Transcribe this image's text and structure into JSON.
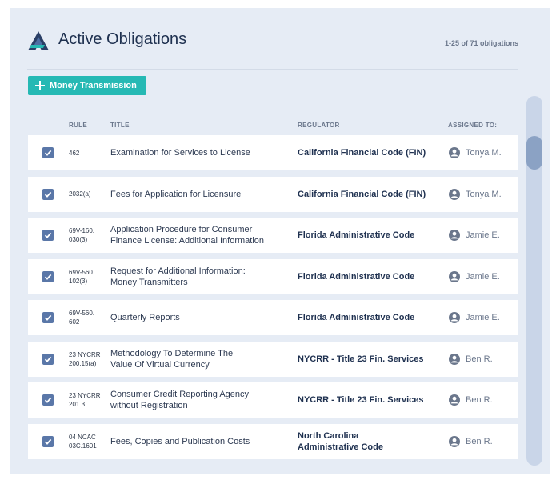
{
  "header": {
    "title": "Active Obligations",
    "count": "1-25 of 71 obligations"
  },
  "add_button": {
    "label": "Money Transmission"
  },
  "columns": {
    "rule": "RULE",
    "title": "TITLE",
    "regulator": "REGULATOR",
    "assigned": "ASSIGNED TO:"
  },
  "rows": [
    {
      "checked": true,
      "rule": [
        "462"
      ],
      "title": [
        "Examination for Services to License"
      ],
      "regulator": [
        "California Financial Code (FIN)"
      ],
      "assignee": "Tonya M."
    },
    {
      "checked": true,
      "rule": [
        "2032(a)"
      ],
      "title": [
        "Fees for Application for Licensure"
      ],
      "regulator": [
        "California Financial Code (FIN)"
      ],
      "assignee": "Tonya M."
    },
    {
      "checked": true,
      "rule": [
        "69V-160.",
        "030(3)"
      ],
      "title": [
        "Application Procedure for Consumer",
        "Finance License: Additional Information"
      ],
      "regulator": [
        "Florida Administrative Code"
      ],
      "assignee": "Jamie E."
    },
    {
      "checked": true,
      "rule": [
        "69V-560.",
        "102(3)"
      ],
      "title": [
        "Request for Additional Information:",
        "Money Transmitters"
      ],
      "regulator": [
        "Florida Administrative Code"
      ],
      "assignee": "Jamie E."
    },
    {
      "checked": true,
      "rule": [
        "69V-560.",
        "602"
      ],
      "title": [
        "Quarterly Reports"
      ],
      "regulator": [
        "Florida Administrative Code"
      ],
      "assignee": "Jamie E."
    },
    {
      "checked": true,
      "rule": [
        "23 NYCRR",
        "200.15(a)"
      ],
      "title": [
        "Methodology To Determine The",
        "Value Of Virtual Currency"
      ],
      "regulator": [
        "NYCRR - Title 23 Fin. Services"
      ],
      "assignee": "Ben R."
    },
    {
      "checked": true,
      "rule": [
        "23 NYCRR",
        "201.3"
      ],
      "title": [
        "Consumer Credit Reporting Agency",
        "without Registration"
      ],
      "regulator": [
        "NYCRR - Title 23 Fin. Services"
      ],
      "assignee": "Ben R."
    },
    {
      "checked": true,
      "rule": [
        "04 NCAC",
        "03C.1601"
      ],
      "title": [
        "Fees, Copies and Publication Costs"
      ],
      "regulator": [
        "North Carolina",
        "Administrative Code"
      ],
      "assignee": "Ben R."
    }
  ],
  "colors": {
    "accent": "#26b9b4",
    "checkbox": "#5a77a8",
    "panel": "#e6ecf5"
  },
  "icons": {
    "logo": "brand-logo-icon",
    "add": "plus-icon",
    "checkbox": "checkmark-icon",
    "assignee": "user-avatar-icon"
  }
}
